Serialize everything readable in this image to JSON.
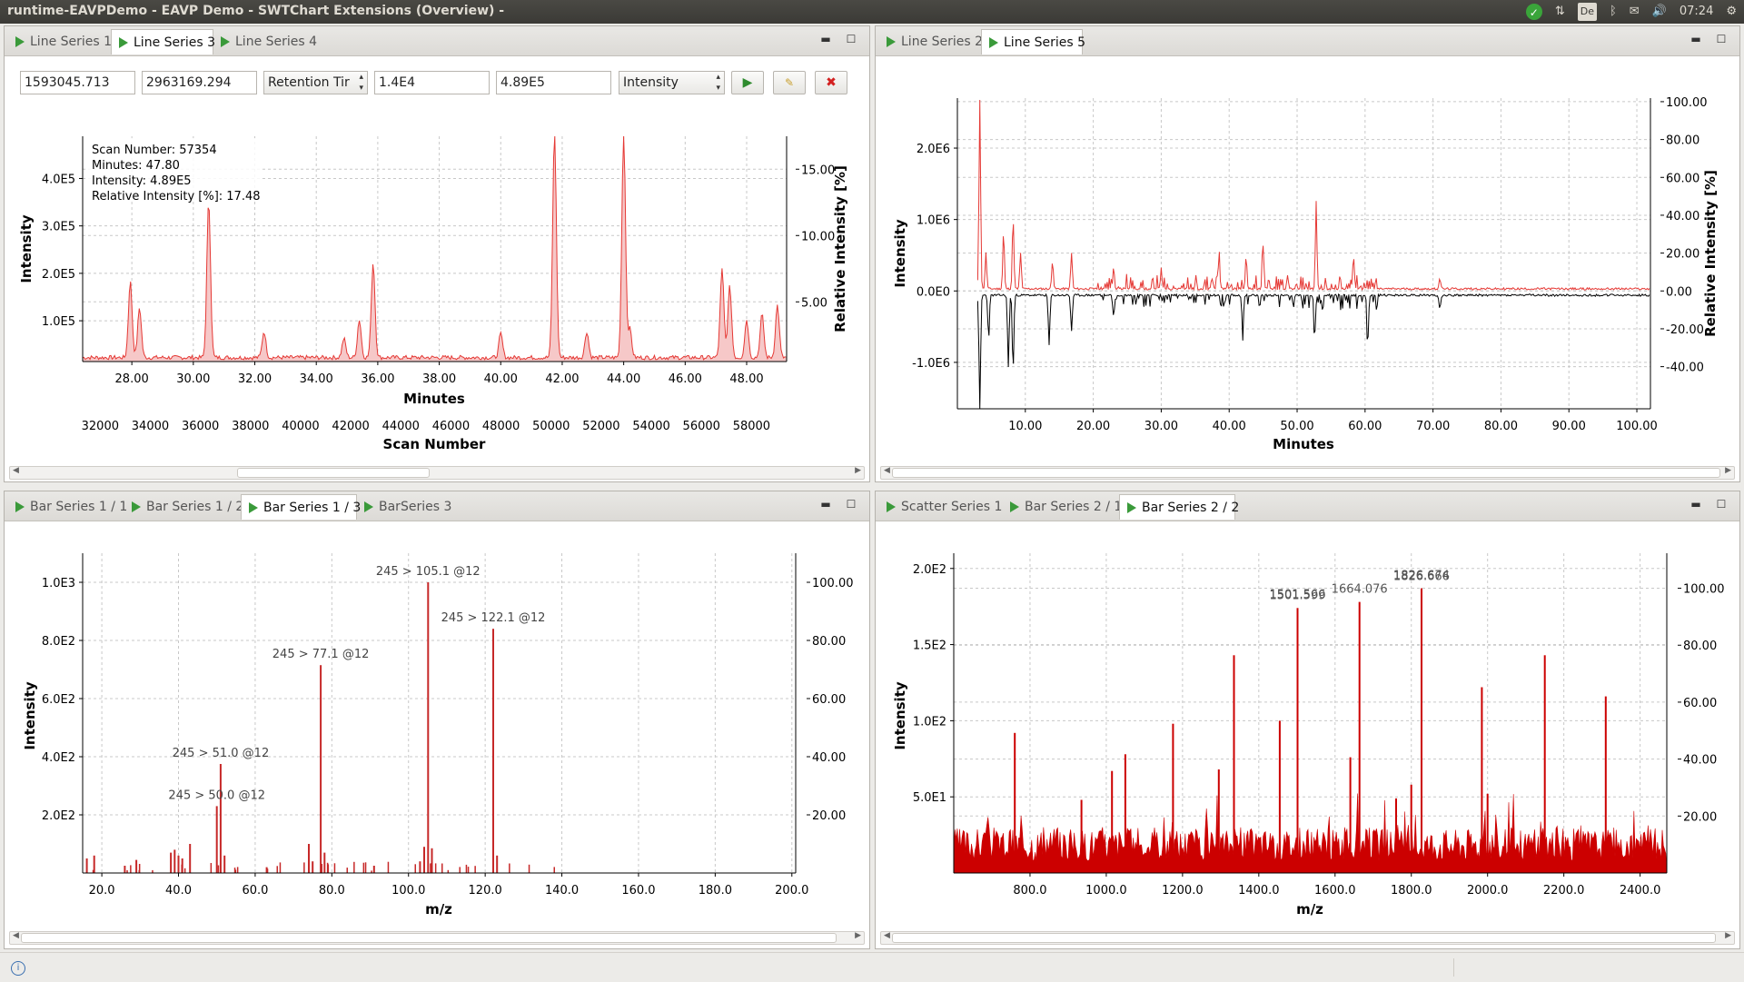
{
  "window": {
    "title": "runtime-EAVPDemo - EAVP Demo - SWTChart Extensions (Overview) -",
    "tray": {
      "time": "07:24",
      "keyboard": "De"
    }
  },
  "panels": {
    "top_left": {
      "tabs": [
        "Line Series 1",
        "Line Series 3",
        "Line Series 4"
      ],
      "active_tab": 1,
      "controls": {
        "x_start": "1593045.713",
        "x_stop": "2963169.294",
        "axis_x_select": "Retention Tir",
        "y_start": "1.4E4",
        "y_stop": "4.89E5",
        "axis_y_select": "Intensity"
      },
      "chart": {
        "primary_x_label": "Minutes",
        "secondary_x_label": "Scan Number",
        "y_label": "Intensity",
        "y2_label": "Relative Intensity [%]",
        "tooltip": [
          "Scan Number: 57354",
          "Minutes: 47.80",
          "Intensity: 4.89E5",
          "Relative Intensity [%]: 17.48"
        ],
        "x_ticks": [
          "28.00",
          "30.00",
          "32.00",
          "34.00",
          "36.00",
          "38.00",
          "40.00",
          "42.00",
          "44.00",
          "46.00",
          "48.00"
        ],
        "scan_ticks": [
          "32000",
          "34000",
          "36000",
          "38000",
          "40000",
          "42000",
          "44000",
          "46000",
          "48000",
          "50000",
          "52000",
          "54000",
          "56000",
          "58000"
        ],
        "y_ticks": [
          "1.0E5",
          "2.0E5",
          "3.0E5",
          "4.0E5"
        ],
        "y2_ticks": [
          "5.00",
          "10.00",
          "15.00"
        ]
      }
    },
    "top_right": {
      "tabs": [
        "Line Series 2",
        "Line Series 5"
      ],
      "active_tab": 1,
      "chart": {
        "x_label": "Minutes",
        "y_label": "Intensity",
        "y2_label": "Relative Intensity [%]",
        "x_ticks": [
          "10.00",
          "20.00",
          "30.00",
          "40.00",
          "50.00",
          "60.00",
          "70.00",
          "80.00",
          "90.00",
          "100.00"
        ],
        "y_ticks": [
          "-1.0E6",
          "0.0E0",
          "1.0E6",
          "2.0E6"
        ],
        "y2_ticks": [
          "-40.00",
          "-20.00",
          "0.00",
          "20.00",
          "40.00",
          "60.00",
          "80.00",
          "100.00"
        ]
      }
    },
    "bottom_left": {
      "tabs": [
        "Bar Series 1 / 1",
        "Bar Series 1 / 2",
        "Bar Series 1 / 3",
        "BarSeries 3"
      ],
      "active_tab": 2,
      "chart": {
        "x_label": "m/z",
        "y_label": "Intensity",
        "x_ticks": [
          "20.0",
          "40.0",
          "60.0",
          "80.0",
          "100.0",
          "120.0",
          "140.0",
          "160.0",
          "180.0",
          "200.0"
        ],
        "y_ticks": [
          "2.0E2",
          "4.0E2",
          "6.0E2",
          "8.0E2",
          "1.0E3"
        ],
        "y2_ticks": [
          "20.00",
          "40.00",
          "60.00",
          "80.00",
          "100.00"
        ],
        "labels": [
          "245 > 105.1 @12",
          "245 > 122.1 @12",
          "245 > 77.1 @12",
          "245 > 51.0 @12",
          "245 > 50.0 @12"
        ]
      }
    },
    "bottom_right": {
      "tabs": [
        "Scatter Series 1",
        "Bar Series 2 / 1",
        "Bar Series 2 / 2"
      ],
      "active_tab": 2,
      "chart": {
        "x_label": "m/z",
        "y_label": "Intensity",
        "x_ticks": [
          "800.0",
          "1000.0",
          "1200.0",
          "1400.0",
          "1600.0",
          "1800.0",
          "2000.0",
          "2200.0",
          "2400.0"
        ],
        "y_ticks": [
          "5.0E1",
          "1.0E2",
          "1.5E2",
          "2.0E2"
        ],
        "y2_ticks": [
          "20.00",
          "40.00",
          "60.00",
          "80.00",
          "100.00"
        ],
        "labels": [
          "1501.566",
          "1501.599",
          "1664.076",
          "1826.674",
          "1826.666"
        ]
      }
    }
  },
  "chart_data": [
    {
      "type": "line",
      "title": "",
      "xlabel": "Minutes",
      "ylabel": "Intensity",
      "xlim": [
        26.4,
        49.3
      ],
      "ylim": [
        14000,
        489000
      ],
      "color": "#e53935",
      "peaks": [
        {
          "x": 27.95,
          "y": 160000
        },
        {
          "x": 28.25,
          "y": 105000
        },
        {
          "x": 30.5,
          "y": 330000
        },
        {
          "x": 32.3,
          "y": 55000
        },
        {
          "x": 34.9,
          "y": 40000
        },
        {
          "x": 35.4,
          "y": 80000
        },
        {
          "x": 35.85,
          "y": 200000
        },
        {
          "x": 40.0,
          "y": 50000
        },
        {
          "x": 41.75,
          "y": 475000
        },
        {
          "x": 42.8,
          "y": 55000
        },
        {
          "x": 44.0,
          "y": 475000
        },
        {
          "x": 44.2,
          "y": 60000
        },
        {
          "x": 47.2,
          "y": 185000
        },
        {
          "x": 47.45,
          "y": 150000
        },
        {
          "x": 48.0,
          "y": 80000
        },
        {
          "x": 48.5,
          "y": 90000
        },
        {
          "x": 49.0,
          "y": 110000
        }
      ]
    },
    {
      "type": "line",
      "title": "",
      "xlabel": "Minutes",
      "ylabel": "Intensity",
      "xlim": [
        0,
        102
      ],
      "ylim": [
        -1650000,
        2700000
      ],
      "series": [
        {
          "name": "",
          "color": "#e53935",
          "peaks": [
            {
              "x": 3.3,
              "y": 2650000
            },
            {
              "x": 4.2,
              "y": 500000
            },
            {
              "x": 6.8,
              "y": 800000
            },
            {
              "x": 8.2,
              "y": 1000000
            },
            {
              "x": 9.3,
              "y": 500000
            },
            {
              "x": 14.0,
              "y": 400000
            },
            {
              "x": 16.8,
              "y": 500000
            },
            {
              "x": 23.0,
              "y": 300000
            },
            {
              "x": 30.0,
              "y": 250000
            },
            {
              "x": 38.5,
              "y": 400000
            },
            {
              "x": 42.5,
              "y": 450000
            },
            {
              "x": 45.0,
              "y": 600000
            },
            {
              "x": 52.8,
              "y": 1050000
            },
            {
              "x": 58.3,
              "y": 450000
            },
            {
              "x": 71.0,
              "y": 150000
            }
          ]
        },
        {
          "name": "",
          "color": "#000000",
          "peaks": [
            {
              "x": 3.3,
              "y": -1600000
            },
            {
              "x": 4.6,
              "y": -600000
            },
            {
              "x": 7.5,
              "y": -1000000
            },
            {
              "x": 8.2,
              "y": -1050000
            },
            {
              "x": 13.5,
              "y": -700000
            },
            {
              "x": 16.8,
              "y": -500000
            },
            {
              "x": 23.0,
              "y": -300000
            },
            {
              "x": 42.0,
              "y": -500000
            },
            {
              "x": 52.6,
              "y": -550000
            },
            {
              "x": 60.4,
              "y": -650000
            },
            {
              "x": 71.0,
              "y": -200000
            }
          ]
        }
      ]
    },
    {
      "type": "bar",
      "title": "",
      "xlabel": "m/z",
      "ylabel": "Intensity",
      "xlim": [
        15,
        201
      ],
      "ylim": [
        0,
        1000
      ],
      "color": "#c62828",
      "x": [
        16.1,
        18.0,
        26.0,
        29.0,
        38.0,
        39.0,
        40.0,
        41.0,
        43.0,
        50.0,
        51.0,
        52.0,
        63.0,
        74.0,
        75.0,
        77.1,
        78.1,
        79.0,
        91.0,
        103.0,
        104.1,
        105.1,
        106.1,
        122.1,
        123.1
      ],
      "values": [
        50,
        60,
        25,
        45,
        70,
        80,
        60,
        50,
        100,
        230,
        375,
        60,
        20,
        100,
        40,
        715,
        70,
        30,
        25,
        40,
        90,
        1000,
        85,
        840,
        60
      ]
    },
    {
      "type": "bar",
      "title": "",
      "xlabel": "m/z",
      "ylabel": "Intensity",
      "xlim": [
        600,
        2470
      ],
      "ylim": [
        0,
        210
      ],
      "color": "#cc0000",
      "x": [
        760,
        935,
        1015,
        1050,
        1175,
        1295,
        1335,
        1455,
        1501.6,
        1640,
        1664.1,
        1760,
        1800,
        1826.7,
        1985,
        2000,
        2150,
        2310
      ],
      "values": [
        92,
        48,
        67,
        78,
        98,
        68,
        143,
        100,
        174,
        76,
        178,
        49,
        58,
        187,
        122,
        52,
        143,
        116
      ]
    }
  ]
}
